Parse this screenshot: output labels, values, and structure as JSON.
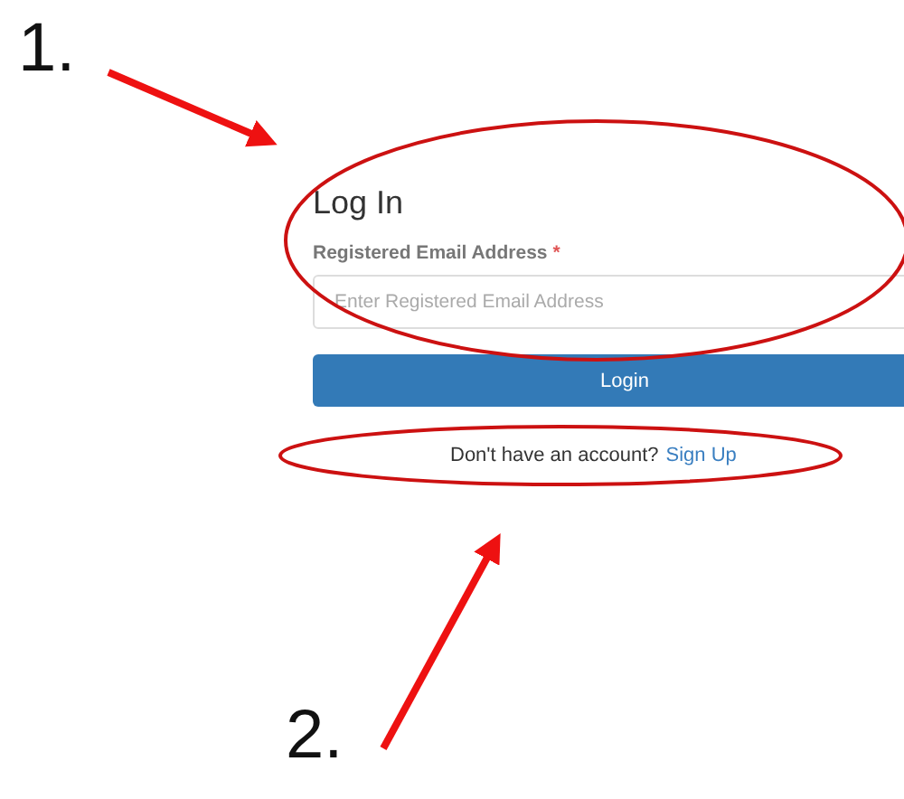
{
  "annotations": [
    {
      "number": "1."
    },
    {
      "number": "2."
    }
  ],
  "login": {
    "title": "Log In",
    "field_label": "Registered Email Address",
    "required_mark": "*",
    "placeholder": "Enter Registered Email Address",
    "button": "Login",
    "prompt": "Don't have an account?",
    "link": "Sign Up"
  }
}
